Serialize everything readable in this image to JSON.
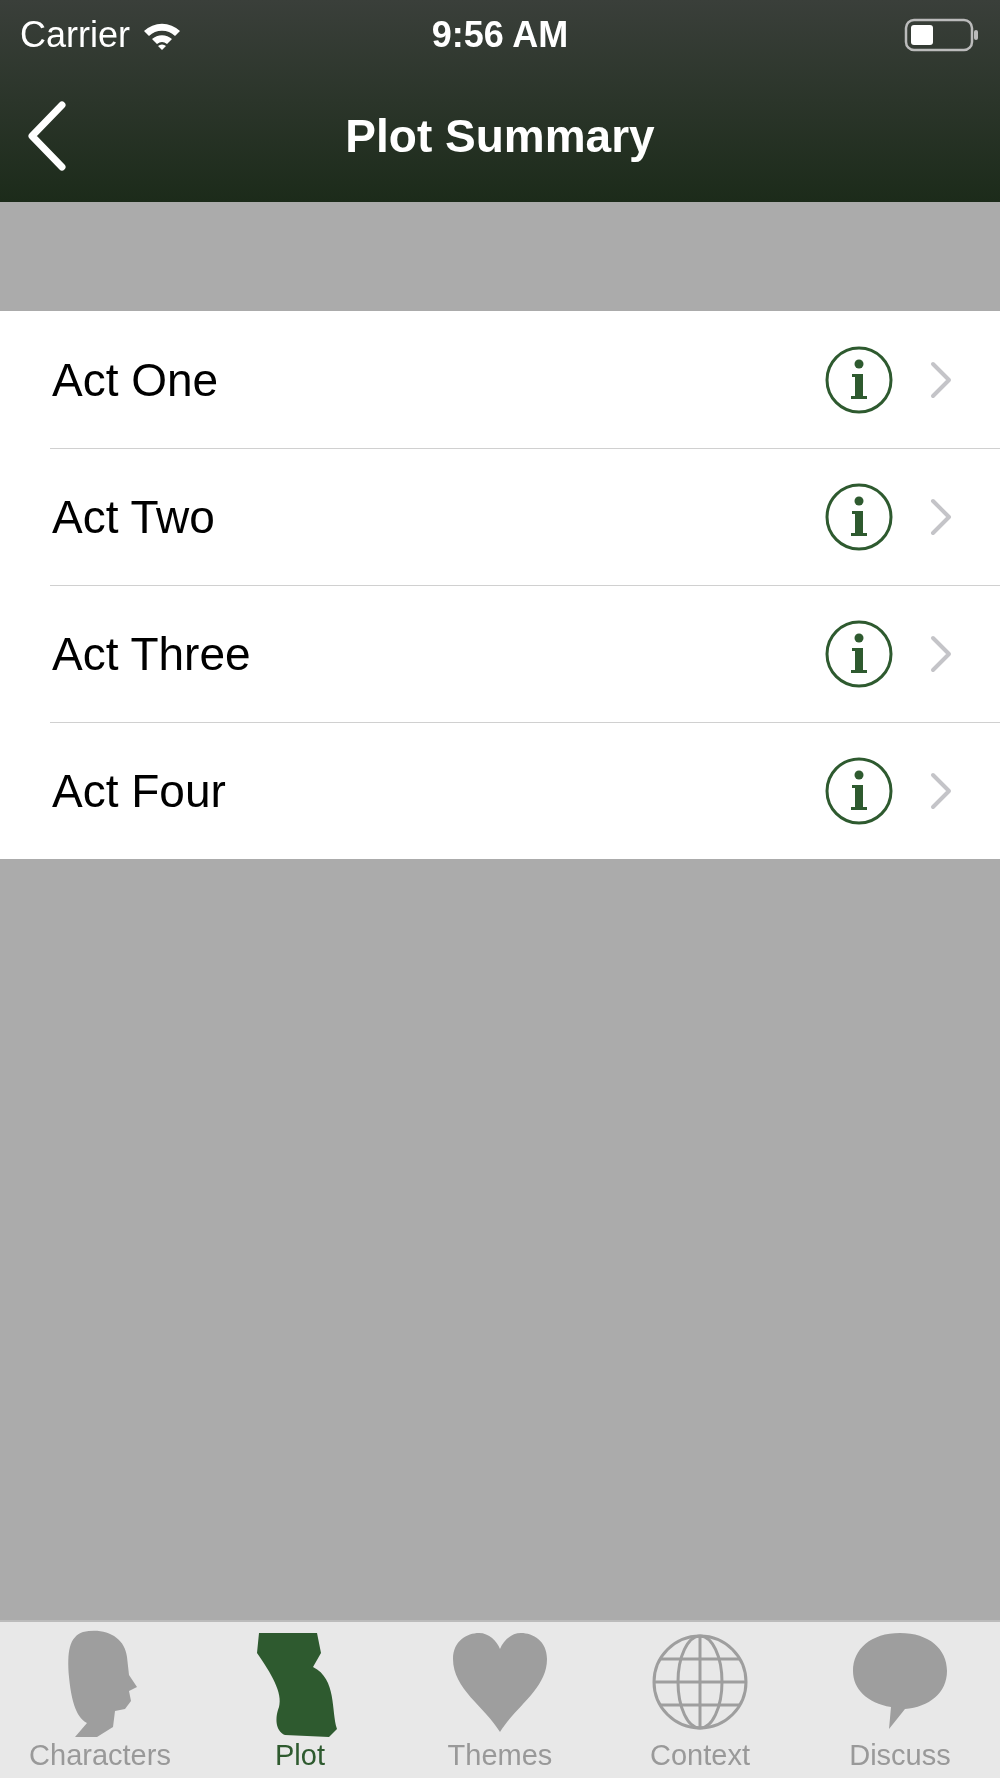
{
  "status_bar": {
    "carrier": "Carrier",
    "time": "9:56 AM"
  },
  "nav_bar": {
    "title": "Plot Summary"
  },
  "rows": [
    {
      "label": "Act One"
    },
    {
      "label": "Act Two"
    },
    {
      "label": "Act Three"
    },
    {
      "label": "Act Four"
    }
  ],
  "tab_bar": [
    {
      "kind": "profile",
      "label": "Characters",
      "selected": false
    },
    {
      "kind": "map",
      "label": "Plot",
      "selected": true
    },
    {
      "kind": "heart",
      "label": "Themes",
      "selected": false
    },
    {
      "kind": "globe",
      "label": "Context",
      "selected": false
    },
    {
      "kind": "bubble",
      "label": "Discuss",
      "selected": false
    }
  ]
}
